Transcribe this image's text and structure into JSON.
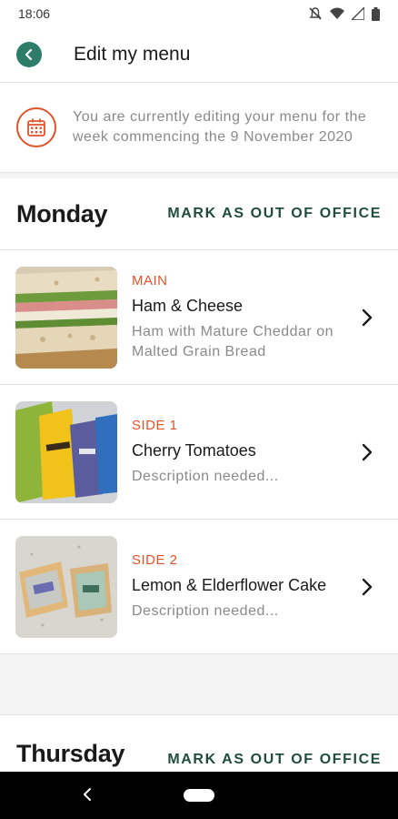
{
  "status_bar": {
    "time": "18:06",
    "icons": [
      "mute-icon",
      "wifi-icon",
      "signal-icon",
      "battery-icon"
    ]
  },
  "app_bar": {
    "title": "Edit my menu",
    "back_icon": "back-arrow-icon",
    "accent_color": "#2e7d6b"
  },
  "notice": {
    "text": "You are currently editing your menu for the week commencing the 9 November 2020",
    "icon": "calendar-icon",
    "icon_color": "#e0532a"
  },
  "days": [
    {
      "title": "Monday",
      "action_label": "MARK AS OUT OF OFFICE",
      "items": [
        {
          "category": "MAIN",
          "name": "Ham & Cheese",
          "description": "Ham with Mature Cheddar on Malted Grain Bread",
          "image": "sandwich-photo"
        },
        {
          "category": "SIDE 1",
          "name": "Cherry Tomatoes",
          "description": "Description needed...",
          "image": "crisp-packets-photo"
        },
        {
          "category": "SIDE 2",
          "name": "Lemon & Elderflower Cake",
          "description": "Description needed...",
          "image": "cake-slices-photo"
        }
      ]
    },
    {
      "title": "Thursday",
      "action_label": "MARK AS OUT OF OFFICE"
    }
  ],
  "colors": {
    "category": "#e0532a",
    "action": "#1f4d3e",
    "muted_text": "#8a8a8a"
  }
}
